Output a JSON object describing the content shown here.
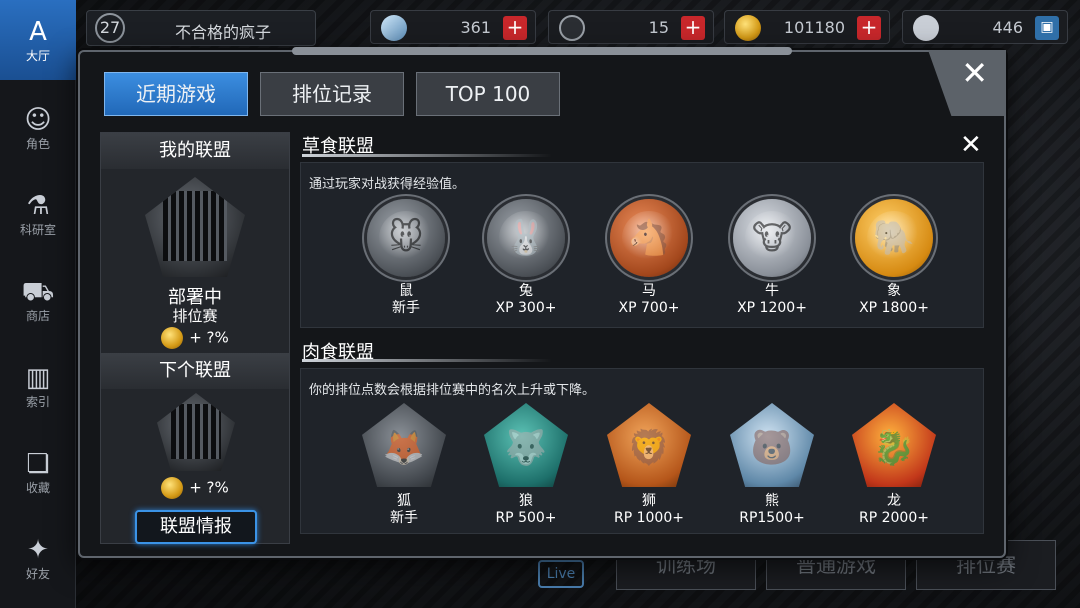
{
  "sidebar": {
    "items": [
      {
        "label": "大厅",
        "icon": "lobby-icon",
        "glyph": "A"
      },
      {
        "label": "角色",
        "icon": "character-icon",
        "glyph": "☺"
      },
      {
        "label": "科研室",
        "icon": "lab-flask-icon",
        "glyph": "⚗"
      },
      {
        "label": "商店",
        "icon": "shop-cart-icon",
        "glyph": "⛟"
      },
      {
        "label": "索引",
        "icon": "index-books-icon",
        "glyph": "▥"
      },
      {
        "label": "收藏",
        "icon": "collection-book-icon",
        "glyph": "❏"
      },
      {
        "label": "好友",
        "icon": "friends-gamepad-icon",
        "glyph": "✦"
      }
    ]
  },
  "player": {
    "level": "27",
    "name": "不合格的疯子"
  },
  "resources": [
    {
      "icon": "crystal-icon",
      "value": "361",
      "plus": "+"
    },
    {
      "icon": "ticket-icon",
      "value": "15",
      "plus": "+"
    },
    {
      "icon": "gold-coin-icon",
      "value": "101180",
      "plus": "+"
    },
    {
      "icon": "bp-paw-icon",
      "value": "446",
      "plus": "▣"
    }
  ],
  "background": {
    "bottom_buttons": [
      "训练场",
      "普通游戏",
      "排位赛"
    ],
    "live_label": "Live"
  },
  "modal": {
    "close_glyph": "✕",
    "tabs": [
      "近期游戏",
      "排位记录",
      "TOP 100"
    ],
    "my_league": {
      "title": "我的联盟",
      "status": "部署中",
      "mode": "排位赛",
      "reward": "+ ?%"
    },
    "next_league": {
      "title": "下个联盟",
      "reward": "+ ?%"
    },
    "info_button": "联盟情报",
    "section_close_glyph": "✕",
    "herbivore": {
      "title": "草食联盟",
      "desc": "通过玩家对战获得经验值。",
      "ranks": [
        {
          "name": "鼠",
          "req": "新手",
          "icon": "rat-medal-icon",
          "glyph": "🐭",
          "tier": "m-gray"
        },
        {
          "name": "兔",
          "req": "XP 300+",
          "icon": "rabbit-medal-icon",
          "glyph": "🐰",
          "tier": "m-gray"
        },
        {
          "name": "马",
          "req": "XP 700+",
          "icon": "horse-medal-icon",
          "glyph": "🐴",
          "tier": "m-copper"
        },
        {
          "name": "牛",
          "req": "XP 1200+",
          "icon": "ox-medal-icon",
          "glyph": "🐮",
          "tier": "m-silver"
        },
        {
          "name": "象",
          "req": "XP 1800+",
          "icon": "elephant-medal-icon",
          "glyph": "🐘",
          "tier": "m-gold"
        }
      ]
    },
    "carnivore": {
      "title": "肉食联盟",
      "desc": "你的排位点数会根据排位赛中的名次上升或下降。",
      "ranks": [
        {
          "name": "狐",
          "req": "新手",
          "icon": "fox-badge-icon",
          "glyph": "🦊",
          "tier": "p-gray"
        },
        {
          "name": "狼",
          "req": "RP 500+",
          "icon": "wolf-badge-icon",
          "glyph": "🐺",
          "tier": "p-teal"
        },
        {
          "name": "狮",
          "req": "RP 1000+",
          "icon": "lion-badge-icon",
          "glyph": "🦁",
          "tier": "p-orange"
        },
        {
          "name": "熊",
          "req": "RP1500+",
          "icon": "bear-badge-icon",
          "glyph": "🐻",
          "tier": "p-ice"
        },
        {
          "name": "龙",
          "req": "RP 2000+",
          "icon": "dragon-badge-icon",
          "glyph": "🐉",
          "tier": "p-red"
        }
      ]
    }
  }
}
